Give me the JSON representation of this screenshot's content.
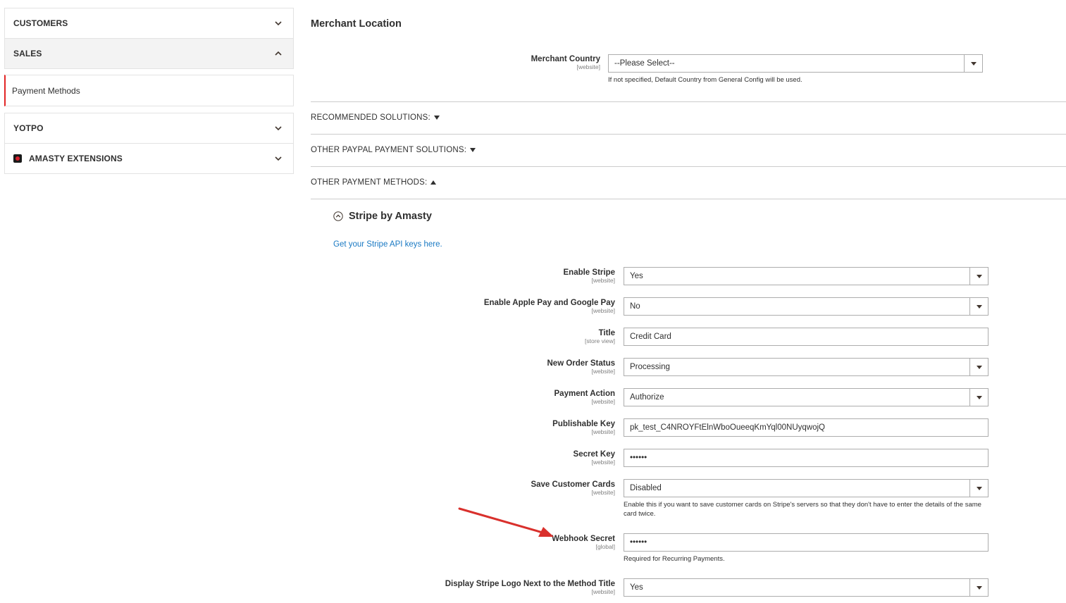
{
  "sidebar": {
    "sections": [
      {
        "label": "CUSTOMERS",
        "expanded": false
      },
      {
        "label": "SALES",
        "expanded": true,
        "items": [
          {
            "label": "Payment Methods",
            "active": true
          }
        ]
      },
      {
        "label": "YOTPO",
        "expanded": false
      },
      {
        "label": "AMASTY EXTENSIONS",
        "expanded": false,
        "icon": "amasty-logo-icon"
      }
    ]
  },
  "main": {
    "merchant_location": {
      "title": "Merchant Location",
      "country_label": "Merchant Country",
      "country_scope": "[website]",
      "country_value": "--Please Select--",
      "country_note": "If not specified, Default Country from General Config will be used."
    },
    "toggles": {
      "recommended": "RECOMMENDED SOLUTIONS:",
      "other_paypal": "OTHER PAYPAL PAYMENT SOLUTIONS:",
      "other_methods": "OTHER PAYMENT METHODS:"
    },
    "stripe": {
      "title": "Stripe by Amasty",
      "api_link": "Get your Stripe API keys here.",
      "fields": [
        {
          "label": "Enable Stripe",
          "scope": "[website]",
          "value": "Yes",
          "type": "select"
        },
        {
          "label": "Enable Apple Pay and Google Pay",
          "scope": "[website]",
          "value": "No",
          "type": "select"
        },
        {
          "label": "Title",
          "scope": "[store view]",
          "value": "Credit Card",
          "type": "text"
        },
        {
          "label": "New Order Status",
          "scope": "[website]",
          "value": "Processing",
          "type": "select"
        },
        {
          "label": "Payment Action",
          "scope": "[website]",
          "value": "Authorize",
          "type": "select"
        },
        {
          "label": "Publishable Key",
          "scope": "[website]",
          "value": "pk_test_C4NROYFtElnWboOueeqKmYql00NUyqwojQ",
          "type": "text"
        },
        {
          "label": "Secret Key",
          "scope": "[website]",
          "value": "••••••",
          "type": "password"
        },
        {
          "label": "Save Customer Cards",
          "scope": "[website]",
          "value": "Disabled",
          "type": "select",
          "note": "Enable this if you want to save customer cards on Stripe's servers so that they don't have to enter the details of the same card twice."
        },
        {
          "label": "Webhook Secret",
          "scope": "[global]",
          "value": "••••••",
          "type": "password",
          "note": "Required for Recurring Payments."
        },
        {
          "label": "Display Stripe Logo Next to the Method Title",
          "scope": "[website]",
          "value": "Yes",
          "type": "select"
        }
      ]
    },
    "colors": {
      "accent": "#e22626",
      "link": "#1979c3",
      "annotation_arrow": "#d9302c"
    }
  }
}
